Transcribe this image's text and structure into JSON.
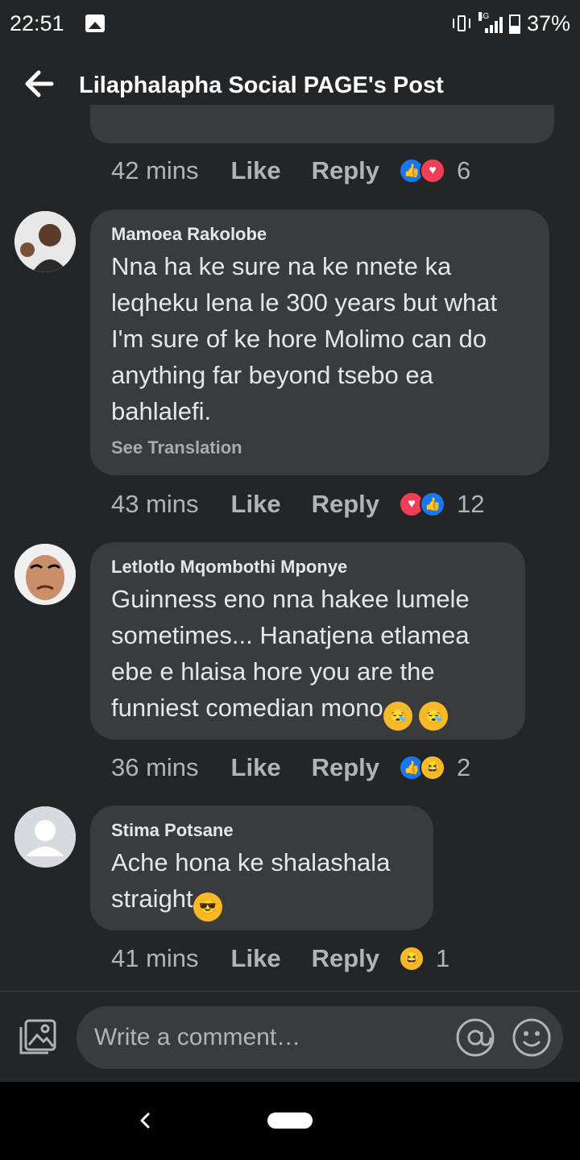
{
  "status_bar": {
    "time": "22:51",
    "network": "4G",
    "battery": "37%"
  },
  "header": {
    "title": "Lilaphalapha Social PAGE's Post"
  },
  "comments": [
    {
      "time": "42 mins",
      "like": "Like",
      "reply": "Reply",
      "reaction_count": "6"
    },
    {
      "author": "Mamoea Rakolobe",
      "lines": [
        "Nna ha ke sure na ke nnete ka",
        "leqheku lena le 300 years but what",
        "I'm sure of ke hore Molimo can do",
        "anything far beyond tsebo ea",
        "bahlalefi."
      ],
      "see_translation": "See Translation",
      "time": "43 mins",
      "like": "Like",
      "reply": "Reply",
      "reaction_count": "12"
    },
    {
      "author": "Letlotlo Mqombothi Mponye",
      "lines": [
        "Guinness eno nna hakee lumele",
        "sometimes... Hanatjena etlamea",
        "ebe e hlaisa hore you are the",
        "funniest comedian mono"
      ],
      "time": "36 mins",
      "like": "Like",
      "reply": "Reply",
      "reaction_count": "2"
    },
    {
      "author": "Stima Potsane",
      "lines": [
        "Ache hona ke shalashala",
        "straight"
      ],
      "time": "41 mins",
      "like": "Like",
      "reply": "Reply",
      "reaction_count": "1"
    }
  ],
  "composer": {
    "placeholder": "Write a comment…"
  },
  "icons": {
    "back": "arrow-left-icon",
    "photo": "photo-icon",
    "mention": "at-icon",
    "emoji": "smile-icon"
  }
}
